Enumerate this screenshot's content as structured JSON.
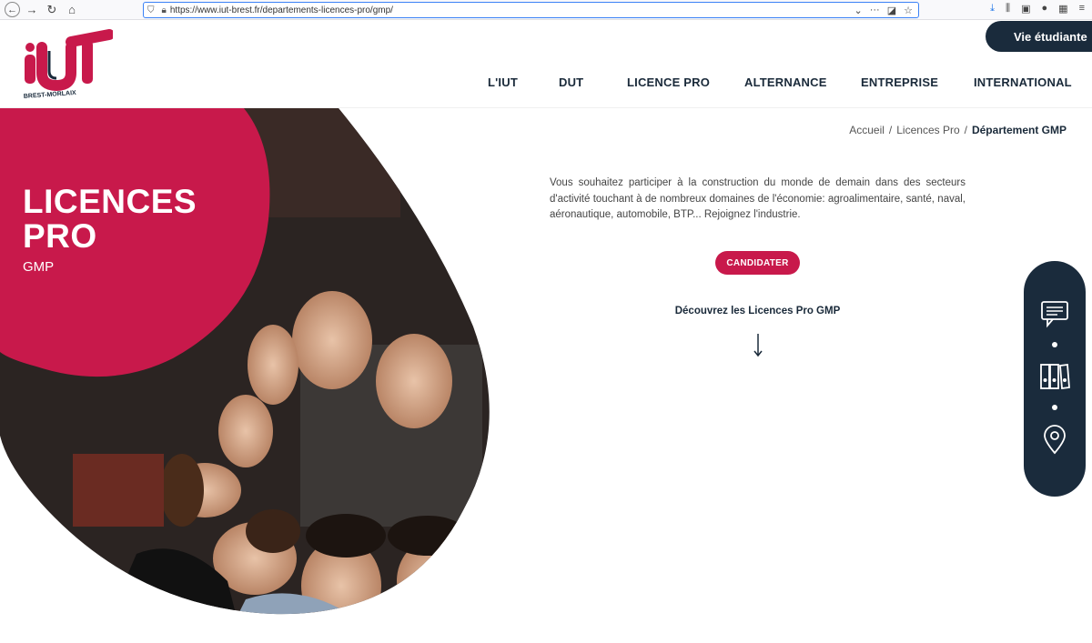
{
  "browser": {
    "url": "https://www.iut-brest.fr/departements-licences-pro/gmp/"
  },
  "header": {
    "logo_text": "IUT",
    "logo_sub": "BREST-MORLAIX",
    "vie_etudiante": "Vie étudiante",
    "nav": [
      "L'IUT",
      "DUT",
      "LICENCE PRO",
      "ALTERNANCE",
      "ENTREPRISE",
      "INTERNATIONAL"
    ]
  },
  "hero": {
    "title_line1": "LICENCES",
    "title_line2": "PRO",
    "subtitle": "GMP"
  },
  "breadcrumb": {
    "items": [
      "Accueil",
      "Licences Pro",
      "Département GMP"
    ],
    "sep": "/"
  },
  "content": {
    "intro": "Vous souhaitez participer à la construction du monde de demain dans des secteurs d'activité touchant à de nombreux domaines de l'économie: agroalimentaire, santé, naval, aéronautique, automobile, BTP... Rejoignez l'industrie.",
    "cta": "CANDIDATER",
    "discover": "Découvrez les Licences Pro GMP"
  },
  "side_widget": {
    "icons": [
      "chat-icon",
      "binders-icon",
      "location-pin-icon"
    ]
  },
  "colors": {
    "brand_pink": "#c8194b",
    "navy": "#1a2b3c"
  }
}
